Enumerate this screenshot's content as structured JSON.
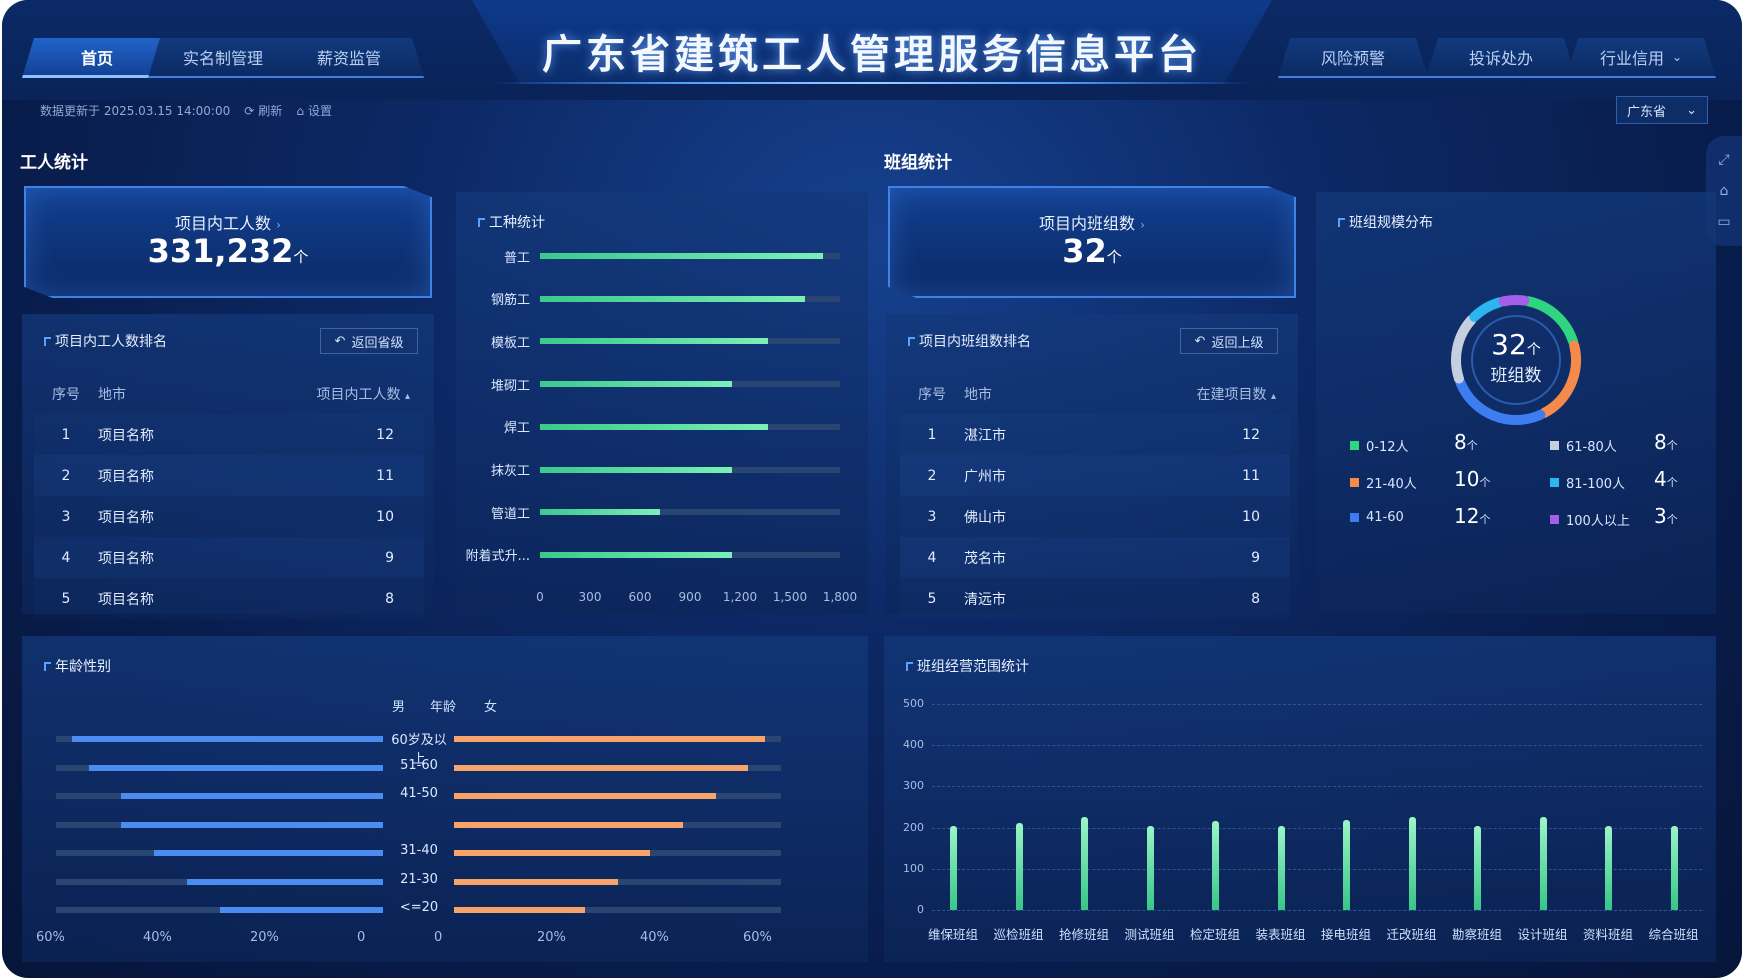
{
  "header": {
    "title": "广东省建筑工人管理服务信息平台",
    "tabs_left": [
      "首页",
      "实名制管理",
      "薪资监管"
    ],
    "tabs_right": [
      "风险预警",
      "投诉处办",
      "行业信用"
    ],
    "active_tab": "首页"
  },
  "meta": {
    "update_text": "数据更新于 2025.03.15 14:00:00",
    "refresh_label": "刷新",
    "settings_label": "设置"
  },
  "region_select": "广东省",
  "workers": {
    "section_title": "工人统计",
    "kpi_label": "项目内工人数",
    "kpi_value": "331,232",
    "kpi_unit": "个",
    "rank_title": "项目内工人数排名",
    "back_button": "返回省级",
    "columns": [
      "序号",
      "地市",
      "项目内工人数"
    ],
    "rows": [
      {
        "no": "1",
        "name": "项目名称",
        "value": "12"
      },
      {
        "no": "2",
        "name": "项目名称",
        "value": "11"
      },
      {
        "no": "3",
        "name": "项目名称",
        "value": "10"
      },
      {
        "no": "4",
        "name": "项目名称",
        "value": "9"
      },
      {
        "no": "5",
        "name": "项目名称",
        "value": "8"
      }
    ]
  },
  "trades": {
    "title": "工种统计",
    "chart_data": {
      "type": "bar",
      "orientation": "horizontal",
      "categories": [
        "普工",
        "钢筋工",
        "模板工",
        "堆砌工",
        "焊工",
        "抹灰工",
        "管道工",
        "附着式升..."
      ],
      "values": [
        1700,
        1590,
        1370,
        1150,
        1370,
        1150,
        720,
        1150
      ],
      "xlim": [
        0,
        1800
      ],
      "xticks": [
        "0",
        "300",
        "600",
        "900",
        "1,200",
        "1,500",
        "1,800"
      ]
    }
  },
  "teams": {
    "section_title": "班组统计",
    "kpi_label": "项目内班组数",
    "kpi_value": "32",
    "kpi_unit": "个",
    "rank_title": "项目内班组数排名",
    "back_button": "返回上级",
    "columns": [
      "序号",
      "地市",
      "在建项目数"
    ],
    "rows": [
      {
        "no": "1",
        "name": "湛江市",
        "value": "12"
      },
      {
        "no": "2",
        "name": "广州市",
        "value": "11"
      },
      {
        "no": "3",
        "name": "佛山市",
        "value": "10"
      },
      {
        "no": "4",
        "name": "茂名市",
        "value": "9"
      },
      {
        "no": "5",
        "name": "清远市",
        "value": "8"
      }
    ]
  },
  "team_size": {
    "title": "班组规模分布",
    "center_value": "32",
    "center_unit": "个",
    "center_label": "班组数",
    "chart_data": {
      "type": "pie",
      "categories": [
        "0-12人",
        "21-40人",
        "41-60",
        "61-80人",
        "81-100人",
        "100人以上"
      ],
      "values": [
        8,
        10,
        12,
        8,
        4,
        3
      ],
      "colors": [
        "#2fd67f",
        "#f58a4b",
        "#3d7df0",
        "#c5cfdf",
        "#2bb6f0",
        "#a45ee8"
      ]
    },
    "legend": [
      {
        "label": "0-12人",
        "value": "8",
        "color": "#2fd67f"
      },
      {
        "label": "21-40人",
        "value": "10",
        "color": "#f58a4b"
      },
      {
        "label": "41-60",
        "value": "12",
        "color": "#3d7df0"
      },
      {
        "label": "61-80人",
        "value": "8",
        "color": "#c5cfdf"
      },
      {
        "label": "81-100人",
        "value": "4",
        "color": "#2bb6f0"
      },
      {
        "label": "100人以上",
        "value": "3",
        "color": "#a45ee8"
      }
    ],
    "unit": "个"
  },
  "age_gender": {
    "title": "年龄性别",
    "male_label": "男",
    "age_label": "年龄",
    "female_label": "女",
    "chart_data": {
      "type": "bar",
      "orientation": "horizontal-butterfly",
      "categories": [
        "60岁及以上",
        "51-60",
        "41-50",
        "31-40",
        "21-30",
        "<=20"
      ],
      "series": [
        {
          "name": "男",
          "values": [
            57,
            54,
            48,
            48,
            42,
            36,
            30
          ]
        },
        {
          "name": "女",
          "values": [
            57,
            54,
            48,
            42,
            36,
            30,
            24
          ]
        }
      ],
      "rows": [
        "60岁及以上",
        "51-60",
        "41-50",
        "",
        "31-40",
        "21-30",
        "<=20"
      ],
      "xlim": [
        0,
        60
      ],
      "left_ticks": [
        "60%",
        "40%",
        "20%",
        "0"
      ],
      "right_ticks": [
        "0",
        "20%",
        "40%",
        "60%"
      ]
    }
  },
  "scope": {
    "title": "班组经营范围统计",
    "chart_data": {
      "type": "bar",
      "categories": [
        "维保班组",
        "巡检班组",
        "抢修班组",
        "测试班组",
        "检定班组",
        "装表班组",
        "接电班组",
        "迁改班组",
        "勘察班组",
        "设计班组",
        "资料班组",
        "综合班组"
      ],
      "values": [
        205,
        212,
        225,
        205,
        215,
        205,
        218,
        225,
        205,
        225,
        205,
        205
      ],
      "ylim": [
        0,
        500
      ],
      "yticks": [
        "500",
        "400",
        "300",
        "200",
        "100",
        "0"
      ]
    }
  }
}
